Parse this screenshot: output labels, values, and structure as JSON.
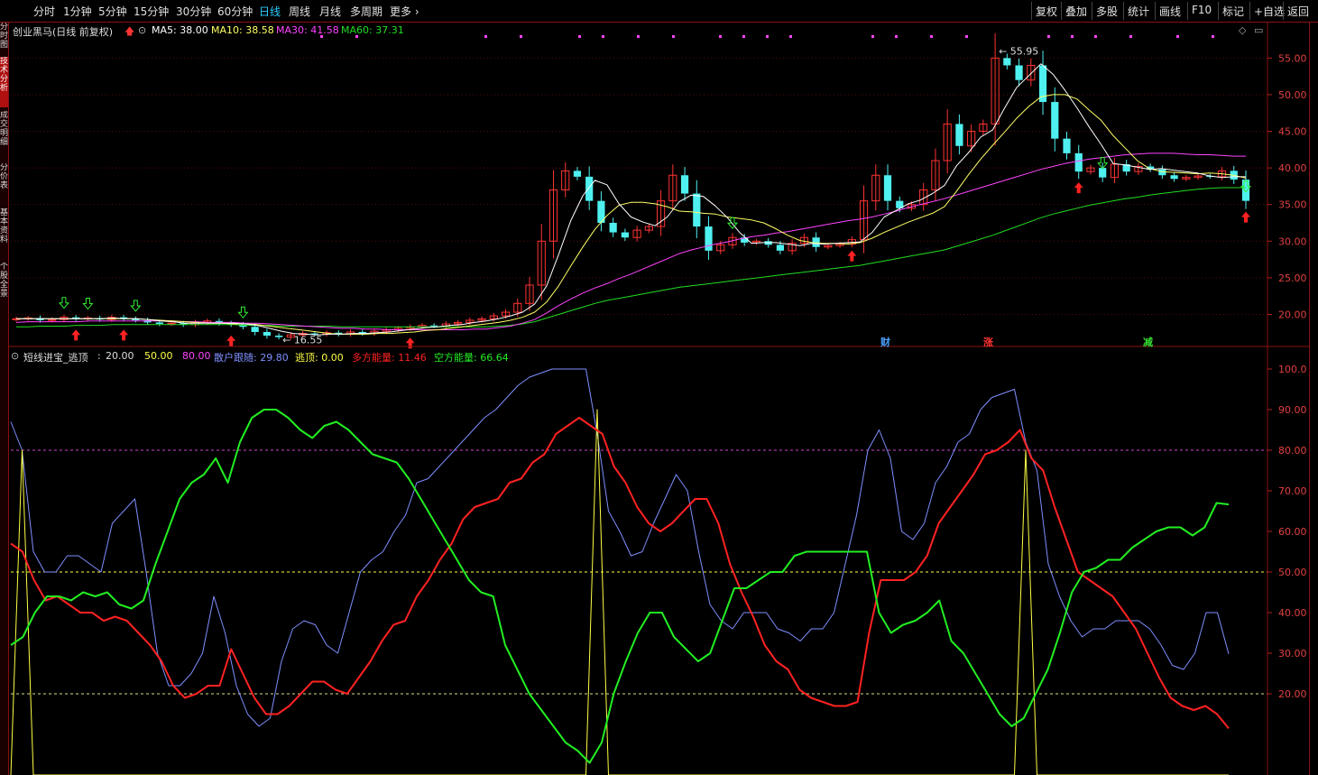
{
  "toolbar": {
    "timeframes": [
      "分时",
      "1分钟",
      "5分钟",
      "15分钟",
      "30分钟",
      "60分钟",
      "日线",
      "周线",
      "月线",
      "多周期",
      "更多"
    ],
    "active": "日线",
    "right_buttons": [
      "复权",
      "叠加",
      "多股",
      "统计",
      "画线",
      "F10",
      "标记",
      "+自选",
      "返回"
    ]
  },
  "left_tabs": [
    "分时图",
    "技术分析",
    "成交明细",
    "分价表",
    "基本资料",
    "个股全景"
  ],
  "main_legend": {
    "stock": "创业黑马(日线 前复权)",
    "ma5": "MA5: 38.00",
    "ma10": "MA10: 38.58",
    "ma30": "MA30: 41.58",
    "ma60": "MA60: 37.31"
  },
  "ind_legend": {
    "name": "短线进宝_逃顶",
    "v20": "20.00",
    "v50": "50.00",
    "v80": "80.00",
    "retail": "散户跟随: 29.80",
    "escape": "逃顶: 0.00",
    "bull": "多方能量: 11.46",
    "bear": "空方能量: 66.64"
  },
  "events": [
    "财",
    "涨",
    "减"
  ],
  "colors": {
    "ma5": "#ffffff",
    "ma10": "#ffff66",
    "ma30": "#ff44ff",
    "ma60": "#22dd22",
    "up": "#ff3333",
    "down": "#4ff0f0",
    "retail": "#7f8fff",
    "escape": "#ffff44",
    "bull": "#ff2222",
    "bear": "#22ee22"
  },
  "chart_data": [
    {
      "type": "candlestick",
      "y_ticks": [
        "55.00",
        "50.00",
        "45.00",
        "40.00",
        "35.00",
        "30.00",
        "25.00",
        "20.00"
      ],
      "ylim": [
        15.5,
        58
      ],
      "annotations": {
        "high": "55.95",
        "low": "16.55"
      },
      "close": [
        19.4,
        19.5,
        19.2,
        19.3,
        19.6,
        19.4,
        19.5,
        19.3,
        19.6,
        19.4,
        19.2,
        18.9,
        18.7,
        18.8,
        18.6,
        18.9,
        19.1,
        18.8,
        18.6,
        18.3,
        17.6,
        17.1,
        16.9,
        17.2,
        17.4,
        17.3,
        17.5,
        17.3,
        17.6,
        17.4,
        17.7,
        17.9,
        18.1,
        18.3,
        18.5,
        18.4,
        18.7,
        18.9,
        19.2,
        19.4,
        19.8,
        20.3,
        21.5,
        24,
        30,
        37,
        39.6,
        38.8,
        35.5,
        32.5,
        31.2,
        30.5,
        31.5,
        32,
        35.5,
        39,
        36.5,
        32,
        28.7,
        29.5,
        30.5,
        29.8,
        30,
        29.5,
        28.7,
        29.7,
        30.5,
        29.2,
        29.4,
        29.6,
        30.2,
        35.5,
        39,
        35.5,
        34.5,
        35,
        37,
        41,
        46,
        43,
        45,
        46,
        55,
        54,
        52,
        54,
        49,
        44,
        42,
        39.5,
        40,
        38.7,
        40.5,
        39.5,
        40.2,
        39.8,
        39,
        38.5,
        38.7,
        38.9,
        38.8,
        39.6,
        38.4,
        35.5
      ],
      "ma5": [
        19.4,
        19.4,
        19.4,
        19.4,
        19.4,
        19.4,
        19.4,
        19.4,
        19.5,
        19.4,
        19.4,
        19.3,
        19.1,
        19,
        18.8,
        18.8,
        18.8,
        18.8,
        18.8,
        18.7,
        18.5,
        18.1,
        17.7,
        17.4,
        17.3,
        17.2,
        17.3,
        17.3,
        17.4,
        17.4,
        17.5,
        17.6,
        17.8,
        18,
        18.2,
        18.3,
        18.5,
        18.6,
        18.9,
        19.1,
        19.4,
        19.8,
        20.3,
        21.4,
        23.9,
        28.2,
        32.8,
        36.2,
        38.3,
        37.7,
        35.1,
        33.3,
        32.6,
        32.1,
        33.3,
        35.4,
        36.3,
        36.1,
        34.8,
        33.2,
        31.2,
        29.7,
        29.8,
        29.8,
        29.6,
        29.4,
        29.7,
        29.6,
        29.7,
        29.8,
        29.9,
        31.2,
        33.3,
        34.2,
        35.1,
        35.6,
        36.5,
        37.6,
        40.3,
        42.1,
        44.2,
        45.2,
        48.2,
        51,
        52.6,
        54.2,
        52.8,
        50.6,
        48.2,
        45.6,
        43.2,
        40.6,
        40.4,
        40.1,
        39.8,
        39.9,
        39.7,
        39.5,
        39.3,
        38.9,
        38.7,
        38.8,
        38.8
      ],
      "ma10": [
        19.4,
        19.4,
        19.4,
        19.4,
        19.4,
        19.4,
        19.4,
        19.4,
        19.4,
        19.4,
        19.4,
        19.3,
        19.2,
        19.1,
        19,
        18.9,
        18.8,
        18.8,
        18.7,
        18.7,
        18.6,
        18.4,
        18.2,
        18,
        17.8,
        17.6,
        17.4,
        17.3,
        17.3,
        17.3,
        17.4,
        17.4,
        17.5,
        17.6,
        17.8,
        17.9,
        18.1,
        18.3,
        18.5,
        18.7,
        18.9,
        19.2,
        19.6,
        20.3,
        21.7,
        23.9,
        26.6,
        29.2,
        31.6,
        33.5,
        34.9,
        35.3,
        35.3,
        35.1,
        34.7,
        34.1,
        34,
        33.8,
        33.7,
        33.3,
        33.1,
        32.9,
        32.5,
        31.7,
        30.8,
        30.1,
        29.8,
        29.7,
        29.7,
        29.6,
        29.8,
        30.4,
        31.2,
        31.9,
        32.6,
        33.2,
        33.8,
        34.7,
        36.8,
        39.1,
        41.2,
        43.1,
        44.9,
        46.8,
        48.4,
        49.7,
        50,
        50,
        49.4,
        47.9,
        46.5,
        44.4,
        42.7,
        41,
        39.9,
        39.5,
        39.4,
        39.3,
        39.2,
        39.3,
        39.2,
        39,
        38.6
      ],
      "ma30": [
        18.9,
        19,
        19,
        19,
        19,
        19,
        19.1,
        19.1,
        19.1,
        19.1,
        19.1,
        19.1,
        19.1,
        19.1,
        19,
        19,
        18.9,
        18.9,
        18.9,
        18.8,
        18.8,
        18.7,
        18.6,
        18.5,
        18.4,
        18.3,
        18.2,
        18.1,
        18.1,
        18,
        18,
        17.9,
        17.9,
        17.9,
        17.9,
        17.9,
        17.9,
        17.9,
        18,
        18,
        18.2,
        18.4,
        18.8,
        19.3,
        20.2,
        21.2,
        22.1,
        22.9,
        23.6,
        24.2,
        24.9,
        25.5,
        26.2,
        26.9,
        27.6,
        28.3,
        28.8,
        29.2,
        29.6,
        29.9,
        30.3,
        30.6,
        30.8,
        31.1,
        31.3,
        31.6,
        31.9,
        32.2,
        32.5,
        32.8,
        33,
        33.3,
        33.7,
        34.1,
        34.6,
        35,
        35.4,
        35.8,
        36.3,
        36.8,
        37.3,
        37.8,
        38.3,
        38.8,
        39.3,
        39.8,
        40.2,
        40.6,
        40.9,
        41.2,
        41.4,
        41.6,
        41.8,
        41.9,
        42,
        42,
        42,
        41.9,
        41.8,
        41.8,
        41.7,
        41.6,
        41.6
      ],
      "ma60": [
        18.3,
        18.3,
        18.4,
        18.4,
        18.4,
        18.5,
        18.5,
        18.5,
        18.6,
        18.6,
        18.6,
        18.6,
        18.6,
        18.6,
        18.6,
        18.6,
        18.6,
        18.6,
        18.6,
        18.5,
        18.5,
        18.5,
        18.4,
        18.4,
        18.4,
        18.4,
        18.4,
        18.3,
        18.3,
        18.3,
        18.3,
        18.3,
        18.3,
        18.3,
        18.3,
        18.3,
        18.3,
        18.3,
        18.3,
        18.3,
        18.4,
        18.5,
        18.7,
        19,
        19.5,
        20,
        20.5,
        21,
        21.5,
        21.9,
        22.2,
        22.5,
        22.8,
        23.1,
        23.4,
        23.7,
        23.9,
        24.1,
        24.3,
        24.5,
        24.7,
        24.9,
        25.1,
        25.3,
        25.5,
        25.7,
        25.9,
        26.1,
        26.3,
        26.5,
        26.7,
        27,
        27.3,
        27.6,
        27.9,
        28.2,
        28.5,
        28.8,
        29.3,
        29.8,
        30.3,
        30.8,
        31.4,
        32,
        32.6,
        33.2,
        33.7,
        34.1,
        34.5,
        34.9,
        35.2,
        35.5,
        35.8,
        36,
        36.3,
        36.5,
        36.7,
        36.9,
        37.1,
        37.2,
        37.3,
        37.3,
        37.3
      ]
    },
    {
      "type": "line",
      "y_ticks": [
        "100.0",
        "90.00",
        "80.00",
        "70.00",
        "60.00",
        "50.00",
        "40.00",
        "30.00",
        "20.00"
      ],
      "ylim": [
        0,
        102
      ],
      "reference_lines": [
        20,
        50,
        80
      ],
      "series": [
        {
          "name": "散户跟随",
          "values": [
            87,
            80,
            55,
            50,
            50,
            54,
            54,
            52,
            50,
            62,
            65,
            68,
            50,
            30,
            22,
            22,
            25,
            30,
            44,
            35,
            22,
            15,
            12,
            14,
            28,
            36,
            38,
            37,
            32,
            30,
            40,
            50,
            53,
            55,
            60,
            64,
            72,
            73,
            76,
            79,
            82,
            85,
            88,
            90,
            93,
            96,
            98,
            99,
            100,
            100,
            100,
            100,
            84,
            65,
            60,
            54,
            55,
            62,
            68,
            74,
            70,
            55,
            42,
            38,
            36,
            40,
            40,
            40,
            36,
            35,
            33,
            36,
            36,
            40,
            52,
            64,
            80,
            85,
            78,
            60,
            58,
            62,
            72,
            76,
            82,
            84,
            90,
            93,
            94,
            95,
            82,
            75,
            52,
            44,
            38,
            34,
            36,
            36,
            38,
            38,
            38,
            36,
            32,
            27,
            26,
            30,
            40,
            40,
            29.8
          ]
        },
        {
          "name": "逃顶",
          "values": [
            0,
            80,
            0,
            0,
            0,
            0,
            0,
            0,
            0,
            0,
            0,
            0,
            0,
            0,
            0,
            0,
            0,
            0,
            0,
            0,
            0,
            0,
            0,
            0,
            0,
            0,
            0,
            0,
            0,
            0,
            0,
            0,
            0,
            0,
            0,
            0,
            0,
            0,
            0,
            0,
            0,
            0,
            0,
            0,
            0,
            0,
            0,
            0,
            0,
            0,
            0,
            0,
            90,
            0,
            0,
            0,
            0,
            0,
            0,
            0,
            0,
            0,
            0,
            0,
            0,
            0,
            0,
            0,
            0,
            0,
            0,
            0,
            0,
            0,
            0,
            0,
            0,
            0,
            0,
            0,
            0,
            0,
            0,
            0,
            0,
            0,
            0,
            0,
            0,
            0,
            80,
            0,
            0,
            0,
            0,
            0,
            0,
            0,
            0,
            0,
            0,
            0,
            0,
            0,
            0,
            0,
            0,
            0,
            0
          ]
        },
        {
          "name": "多方能量",
          "values": [
            57,
            55,
            48,
            43,
            44,
            42,
            40,
            40,
            38,
            39,
            38,
            35,
            32,
            28,
            22,
            19,
            20,
            22,
            22,
            31,
            25,
            19,
            15,
            15,
            17,
            20,
            23,
            23,
            21,
            20,
            24,
            28,
            33,
            37,
            38,
            44,
            48,
            53,
            57,
            63,
            66,
            67,
            68,
            72,
            73,
            77,
            79,
            84,
            86,
            88,
            86,
            84,
            76,
            72,
            66,
            62,
            60,
            62,
            65,
            68,
            68,
            62,
            52,
            45,
            39,
            32,
            28,
            26,
            21,
            19,
            18,
            17,
            17,
            18,
            35,
            48,
            48,
            48,
            50,
            54,
            62,
            66,
            70,
            74,
            79,
            80,
            82,
            85,
            78,
            75,
            66,
            58,
            50,
            48,
            46,
            44,
            40,
            36,
            30,
            24,
            19,
            17,
            16,
            17,
            15,
            11.46
          ]
        },
        {
          "name": "空方能量",
          "values": [
            32,
            34,
            40,
            44,
            44,
            43,
            45,
            44,
            45,
            42,
            41,
            43,
            52,
            60,
            68,
            72,
            74,
            78,
            72,
            82,
            88,
            90,
            90,
            88,
            85,
            83,
            86,
            87,
            85,
            82,
            79,
            78,
            77,
            73,
            68,
            63,
            58,
            53,
            48,
            45,
            44,
            32,
            26,
            20,
            16,
            12,
            8,
            6,
            3,
            8,
            20,
            28,
            35,
            40,
            40,
            34,
            31,
            28,
            30,
            38,
            46,
            46,
            48,
            50,
            50,
            54,
            55,
            55,
            55,
            55,
            55,
            55,
            40,
            35,
            37,
            38,
            40,
            43,
            33,
            30,
            25,
            20,
            15,
            12,
            14,
            20,
            26,
            35,
            45,
            50,
            51,
            53,
            53,
            56,
            58,
            60,
            61,
            61,
            59,
            61,
            67,
            66.64
          ]
        }
      ]
    }
  ]
}
